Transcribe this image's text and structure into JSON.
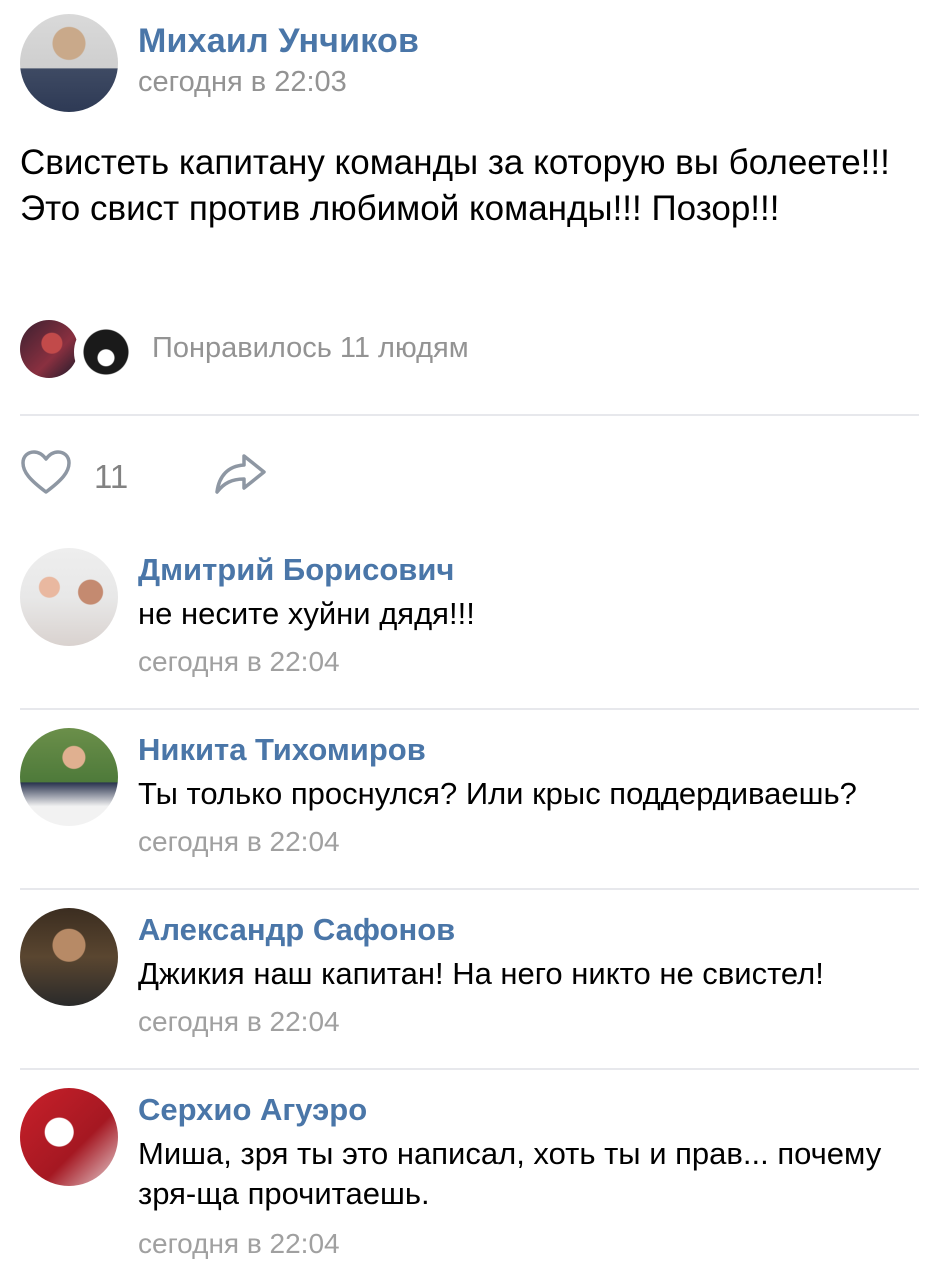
{
  "post": {
    "author": "Михаил Унчиков",
    "time": "сегодня в 22:03",
    "text": "Свистеть капитану команды за которую вы болеете!!! Это свист против любимой команды!!! Позор!!!",
    "likes_summary": "Понравилось 11 людям",
    "like_count": "11",
    "icons": {
      "like": "heart-icon",
      "share": "share-arrow-icon"
    }
  },
  "comments": [
    {
      "author": "Дмитрий Борисович",
      "text": "не несите хуйни дядя!!!",
      "time": "сегодня в 22:04"
    },
    {
      "author": "Никита Тихомиров",
      "text": "Ты только проснулся? Или крыс поддердиваешь?",
      "time": "сегодня в 22:04"
    },
    {
      "author": "Александр Сафонов",
      "text": "Джикия наш капитан! На него никто не свистел!",
      "time": "сегодня в 22:04"
    },
    {
      "author": "Серхио Агуэро",
      "text": "Миша, зря ты это написал, хоть ты и прав... почему зря-ща прочитаешь.",
      "time": "сегодня в 22:04"
    }
  ],
  "colors": {
    "link": "#4a76a8",
    "secondary": "#939393",
    "divider": "#e7e8ec"
  }
}
